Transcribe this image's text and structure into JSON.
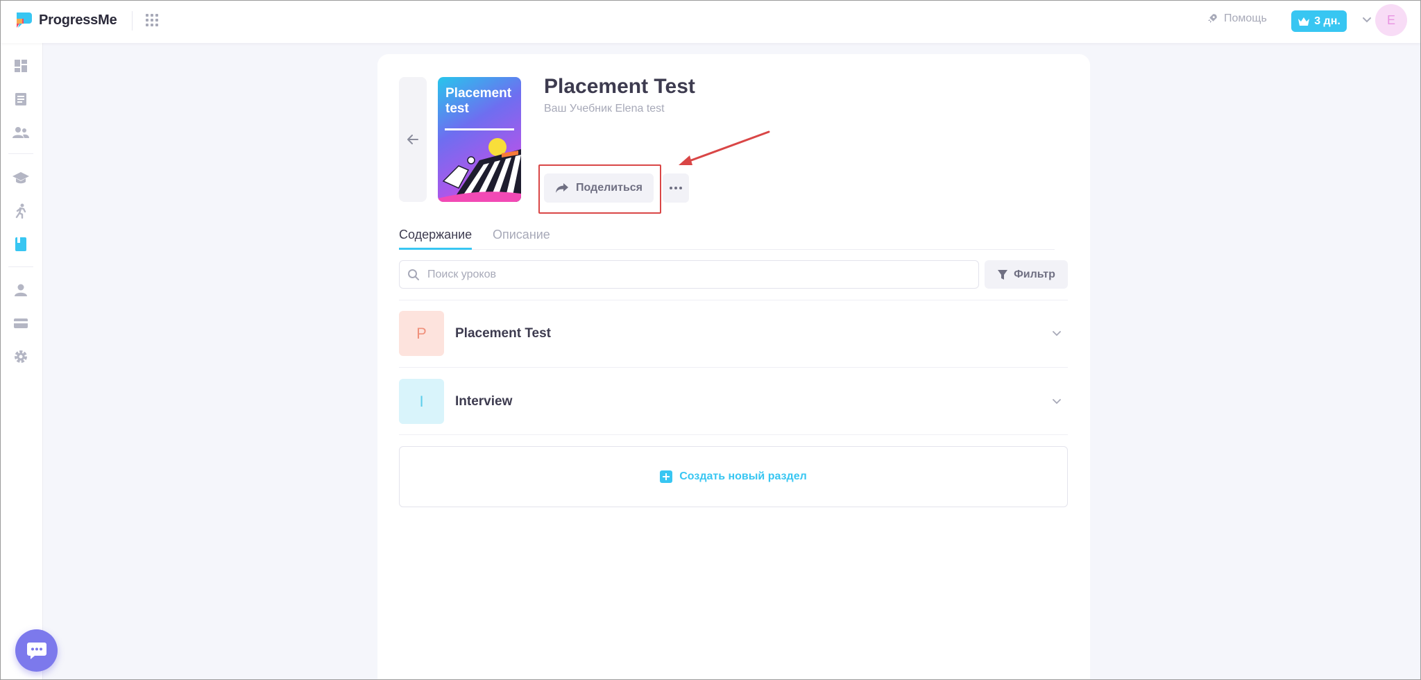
{
  "app": {
    "brand": "ProgressMe",
    "help_label": "Помощь",
    "trial_label": "3 дн.",
    "avatar_initial": "E",
    "accent_color": "#38c6f2"
  },
  "sidebar": {
    "items": [
      {
        "name": "dashboard-icon"
      },
      {
        "name": "lessons-icon"
      },
      {
        "name": "students-icon"
      },
      {
        "name": "courses-icon"
      },
      {
        "name": "activity-icon"
      },
      {
        "name": "textbook-icon",
        "active": true
      },
      {
        "name": "profile-icon"
      },
      {
        "name": "payment-icon"
      },
      {
        "name": "settings-icon"
      }
    ]
  },
  "book": {
    "cover_title": "Placement test",
    "title": "Placement Test",
    "subtitle": "Ваш Учебник Elena test",
    "share_label": "Поделиться"
  },
  "tabs": {
    "content": "Содержание",
    "description": "Описание"
  },
  "search": {
    "placeholder": "Поиск уроков",
    "value": ""
  },
  "filter_label": "Фильтр",
  "sections": [
    {
      "letter": "P",
      "title": "Placement Test",
      "badge_bg": "#fde3dd",
      "badge_fg": "#f0917c"
    },
    {
      "letter": "I",
      "title": "Interview",
      "badge_bg": "#d9f4fb",
      "badge_fg": "#5bcdeb"
    }
  ],
  "create_section_label": "Создать новый раздел"
}
